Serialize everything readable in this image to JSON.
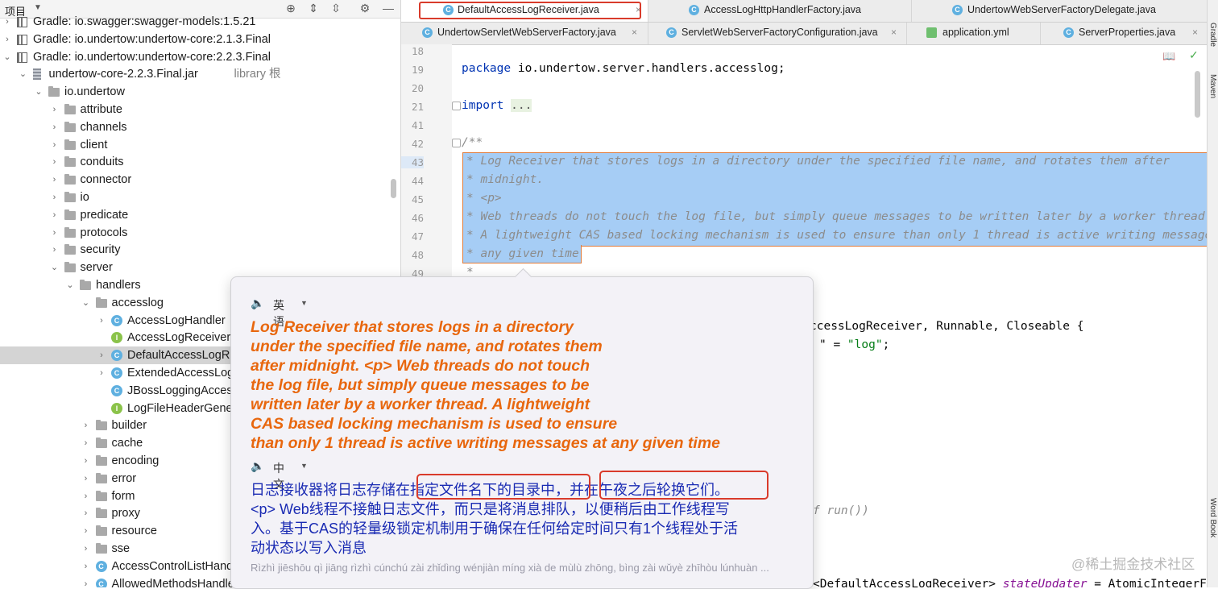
{
  "project_panel": {
    "title": "项目",
    "tree": [
      {
        "label": "Gradle: io.swagger:swagger-models:1.5.21",
        "suffix": "",
        "icon": "gradle-library-icon",
        "arrow": "›",
        "indent": 0
      },
      {
        "label": "Gradle: io.undertow:undertow-core:2.1.3.Final",
        "suffix": "",
        "icon": "gradle-library-icon",
        "arrow": "›",
        "indent": 0
      },
      {
        "label": "Gradle: io.undertow:undertow-core:2.2.3.Final",
        "suffix": "",
        "icon": "gradle-library-icon",
        "arrow": "⌄",
        "indent": 0
      },
      {
        "label": "undertow-core-2.2.3.Final.jar",
        "suffix": "library 根",
        "icon": "jar-icon",
        "arrow": "⌄",
        "indent": 1
      },
      {
        "label": "io.undertow",
        "suffix": "",
        "icon": "package-icon",
        "arrow": "⌄",
        "indent": 2
      },
      {
        "label": "attribute",
        "suffix": "",
        "icon": "package-icon",
        "arrow": "›",
        "indent": 3
      },
      {
        "label": "channels",
        "suffix": "",
        "icon": "package-icon",
        "arrow": "›",
        "indent": 3
      },
      {
        "label": "client",
        "suffix": "",
        "icon": "package-icon",
        "arrow": "›",
        "indent": 3
      },
      {
        "label": "conduits",
        "suffix": "",
        "icon": "package-icon",
        "arrow": "›",
        "indent": 3
      },
      {
        "label": "connector",
        "suffix": "",
        "icon": "package-icon",
        "arrow": "›",
        "indent": 3
      },
      {
        "label": "io",
        "suffix": "",
        "icon": "package-icon",
        "arrow": "›",
        "indent": 3
      },
      {
        "label": "predicate",
        "suffix": "",
        "icon": "package-icon",
        "arrow": "›",
        "indent": 3
      },
      {
        "label": "protocols",
        "suffix": "",
        "icon": "package-icon",
        "arrow": "›",
        "indent": 3
      },
      {
        "label": "security",
        "suffix": "",
        "icon": "package-icon",
        "arrow": "›",
        "indent": 3
      },
      {
        "label": "server",
        "suffix": "",
        "icon": "package-icon",
        "arrow": "⌄",
        "indent": 3
      },
      {
        "label": "handlers",
        "suffix": "",
        "icon": "package-icon",
        "arrow": "⌄",
        "indent": 4
      },
      {
        "label": "accesslog",
        "suffix": "",
        "icon": "package-icon",
        "arrow": "⌄",
        "indent": 5
      },
      {
        "label": "AccessLogHandler",
        "suffix": "",
        "icon": "class-icon",
        "arrow": "›",
        "indent": 6
      },
      {
        "label": "AccessLogReceiver",
        "suffix": "",
        "icon": "interface-icon",
        "arrow": "",
        "indent": 6
      },
      {
        "label": "DefaultAccessLogReceiver",
        "suffix": "",
        "icon": "class-icon",
        "arrow": "›",
        "indent": 6,
        "selected": true
      },
      {
        "label": "ExtendedAccessLogParser",
        "suffix": "",
        "icon": "class-icon",
        "arrow": "›",
        "indent": 6
      },
      {
        "label": "JBossLoggingAccessLogReceiver",
        "suffix": "",
        "icon": "class-icon",
        "arrow": "",
        "indent": 6
      },
      {
        "label": "LogFileHeaderGenerator",
        "suffix": "",
        "icon": "interface-icon",
        "arrow": "",
        "indent": 6
      },
      {
        "label": "builder",
        "suffix": "",
        "icon": "package-icon",
        "arrow": "›",
        "indent": 5
      },
      {
        "label": "cache",
        "suffix": "",
        "icon": "package-icon",
        "arrow": "›",
        "indent": 5
      },
      {
        "label": "encoding",
        "suffix": "",
        "icon": "package-icon",
        "arrow": "›",
        "indent": 5
      },
      {
        "label": "error",
        "suffix": "",
        "icon": "package-icon",
        "arrow": "›",
        "indent": 5
      },
      {
        "label": "form",
        "suffix": "",
        "icon": "package-icon",
        "arrow": "›",
        "indent": 5
      },
      {
        "label": "proxy",
        "suffix": "",
        "icon": "package-icon",
        "arrow": "›",
        "indent": 5
      },
      {
        "label": "resource",
        "suffix": "",
        "icon": "package-icon",
        "arrow": "›",
        "indent": 5
      },
      {
        "label": "sse",
        "suffix": "",
        "icon": "package-icon",
        "arrow": "›",
        "indent": 5
      },
      {
        "label": "AccessControlListHandler",
        "suffix": "",
        "icon": "class-icon",
        "arrow": "›",
        "indent": 5
      },
      {
        "label": "AllowedMethodsHandler",
        "suffix": "",
        "icon": "class-icon",
        "arrow": "›",
        "indent": 5
      }
    ]
  },
  "editor": {
    "tabs_row1": [
      {
        "label": "DefaultAccessLogReceiver.java",
        "active": true
      },
      {
        "label": "AccessLogHttpHandlerFactory.java",
        "active": false
      },
      {
        "label": "UndertowWebServerFactoryDelegate.java",
        "active": false
      }
    ],
    "tabs_row2": [
      {
        "label": "UndertowServletWebServerFactory.java",
        "type": "java"
      },
      {
        "label": "ServletWebServerFactoryConfiguration.java",
        "type": "java"
      },
      {
        "label": "application.yml",
        "type": "yml"
      },
      {
        "label": "ServerProperties.java",
        "type": "java"
      }
    ],
    "line_numbers": [
      "18",
      "19",
      "20",
      "21",
      "41",
      "42",
      "43",
      "44",
      "45",
      "46",
      "47",
      "48",
      "49"
    ],
    "code": {
      "package_kw": "package",
      "package_name": " io.undertow.server.handlers.accesslog;",
      "import_kw": "import",
      "import_fold": "...",
      "doc_open": "/**",
      "doc43": "* Log Receiver that stores logs in a directory under the specified file name, and rotates them after",
      "doc44": "* midnight.",
      "doc45": "* <p>",
      "doc46": "* Web threads do not touch the log file, but simply queue messages to be written later by a worker thread.",
      "doc47": "* A lightweight CAS based locking mechanism is used to ensure than only 1 thread is active writing messages at",
      "doc48": "* any given time",
      "doc49": "*",
      "frag_class": "ccessLogReceiver, Runnable, Closeable {",
      "frag_str_pre": "\" = ",
      "frag_str": "\"log\"",
      "frag_str_post": ";",
      "frag_run": "f run())",
      "frag_updater_a": "<DefaultAccessLogReceiver> ",
      "frag_updater_b": "stateUpdater",
      "frag_updater_c": " = AtomicIntegerF"
    },
    "right_strip": [
      "Gradle",
      "Maven",
      "Word Book"
    ]
  },
  "translation_popup": {
    "source_lang": "英语",
    "target_lang": "中文",
    "source_lines": [
      "Log Receiver that stores logs in a directory",
      "under the specified file name, and rotates them",
      "after midnight. <p> Web threads do not touch",
      "the log file, but simply queue messages to be",
      "written later by a worker thread. A lightweight",
      "CAS based locking mechanism is used to ensure",
      "than only 1 thread is active writing messages at any given time"
    ],
    "target_lines": [
      "日志接收器将日志存储在指定文件名下的目录中，并在午夜之后轮换它们。",
      "<p> Web线程不接触日志文件，而只是将消息排队，以便稍后由工作线程写",
      "入。基于CAS的轻量级锁定机制用于确保在任何给定时间只有1个线程处于活",
      "动状态以写入消息"
    ],
    "pinyin": "Rìzhì jiēshōu qì jiāng rìzhì cúnchú zài zhǐdìng wénjiàn míng xià de mùlù zhōng, bìng zài wǔyè zhīhòu lúnhuàn ..."
  },
  "watermark": "@稀土掘金技术社区",
  "colors": {
    "highlight_box": "#d93b2b",
    "source_text": "#e8670e",
    "target_text": "#1a2bb3",
    "selection": "#a6cdf5"
  }
}
